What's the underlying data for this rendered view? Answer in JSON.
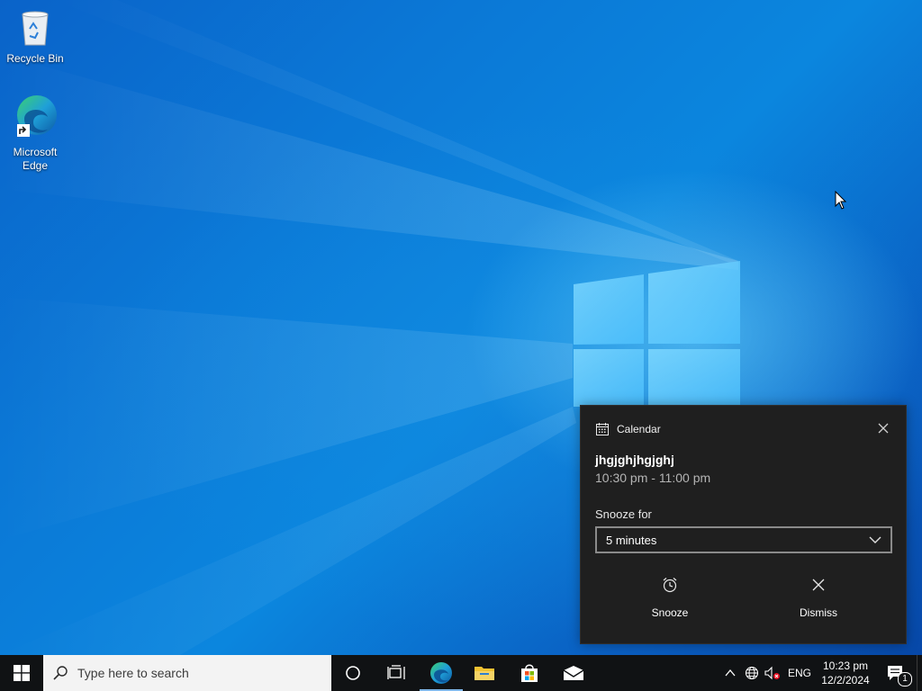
{
  "desktop": {
    "icons": [
      {
        "label": "Recycle Bin",
        "icon": "recycle-bin-icon"
      },
      {
        "label": "Microsoft Edge",
        "icon": "edge-icon"
      }
    ]
  },
  "notification": {
    "app": "Calendar",
    "app_icon": "calendar-icon",
    "title": "jhgjghjhgjghj",
    "time_range": "10:30 pm - 11:00 pm",
    "snooze_label": "Snooze for",
    "snooze_value": "5 minutes",
    "snooze_button": "Snooze",
    "dismiss_button": "Dismiss"
  },
  "taskbar": {
    "search_placeholder": "Type here to search",
    "pinned": [
      "cortana-icon",
      "task-view-icon",
      "edge-icon",
      "file-explorer-icon",
      "store-icon",
      "mail-icon"
    ],
    "tray": {
      "language": "ENG",
      "time": "10:23 pm",
      "date": "12/2/2024",
      "notification_count": "1"
    }
  },
  "colors": {
    "taskbar": "#101214",
    "toast_bg": "#1f1f1f",
    "accent": "#0b78d6"
  }
}
